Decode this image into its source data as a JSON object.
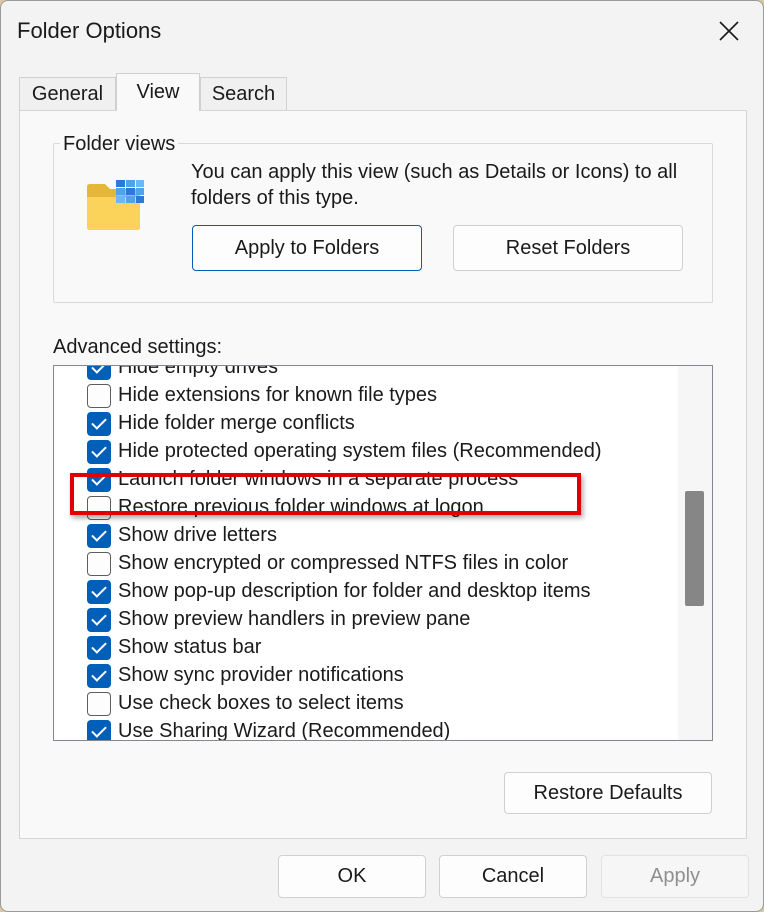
{
  "window": {
    "title": "Folder Options"
  },
  "tabs": [
    {
      "label": "General",
      "active": false
    },
    {
      "label": "View",
      "active": true
    },
    {
      "label": "Search",
      "active": false
    }
  ],
  "folder_views": {
    "title": "Folder views",
    "description": "You can apply this view (such as Details or Icons) to all folders of this type.",
    "apply_button": "Apply to Folders",
    "reset_button": "Reset Folders"
  },
  "advanced": {
    "label": "Advanced settings:",
    "items": [
      {
        "label": "Hide empty drives",
        "checked": true
      },
      {
        "label": "Hide extensions for known file types",
        "checked": false
      },
      {
        "label": "Hide folder merge conflicts",
        "checked": true
      },
      {
        "label": "Hide protected operating system files (Recommended)",
        "checked": true
      },
      {
        "label": "Launch folder windows in a separate process",
        "checked": true,
        "highlighted": true
      },
      {
        "label": "Restore previous folder windows at logon",
        "checked": false
      },
      {
        "label": "Show drive letters",
        "checked": true
      },
      {
        "label": "Show encrypted or compressed NTFS files in color",
        "checked": false
      },
      {
        "label": "Show pop-up description for folder and desktop items",
        "checked": true
      },
      {
        "label": "Show preview handlers in preview pane",
        "checked": true
      },
      {
        "label": "Show status bar",
        "checked": true
      },
      {
        "label": "Show sync provider notifications",
        "checked": true
      },
      {
        "label": "Use check boxes to select items",
        "checked": false
      },
      {
        "label": "Use Sharing Wizard (Recommended)",
        "checked": true
      }
    ],
    "restore_defaults": "Restore Defaults"
  },
  "footer": {
    "ok": "OK",
    "cancel": "Cancel",
    "apply": "Apply",
    "apply_enabled": false
  },
  "colors": {
    "accent": "#005fb8",
    "highlight": "#e00000"
  },
  "icons": {
    "close": "close-icon",
    "folder": "folder-view-icon"
  }
}
